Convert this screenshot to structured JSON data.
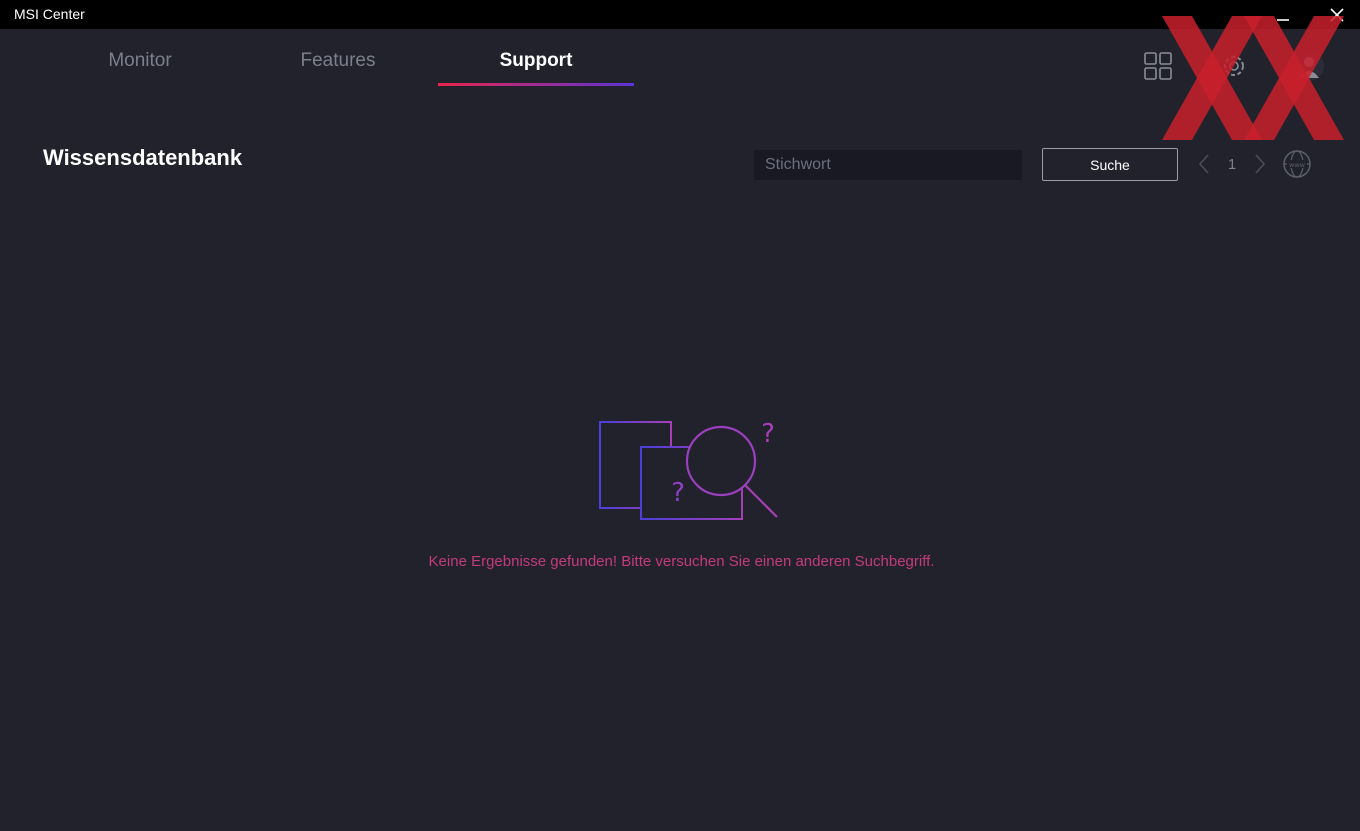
{
  "window": {
    "title": "MSI Center",
    "minimize_icon": "minimize-icon",
    "close_icon": "close-icon"
  },
  "tabs": [
    {
      "label": "Monitor",
      "active": false
    },
    {
      "label": "Features",
      "active": false
    },
    {
      "label": "Support",
      "active": true
    }
  ],
  "toolbar_icons": [
    "grid-icon",
    "gear-icon",
    "user-icon"
  ],
  "page": {
    "title": "Wissensdatenbank"
  },
  "search": {
    "placeholder": "Stichwort",
    "value": "",
    "button_label": "Suche"
  },
  "pager": {
    "current_page": "1",
    "prev_icon": "chevron-left-icon",
    "next_icon": "chevron-right-icon",
    "web_icon": "globe-www-icon"
  },
  "empty_state": {
    "icon": "no-results-illustration",
    "message": "Keine Ergebnisse gefunden! Bitte versuchen Sie einen anderen Suchbegriff."
  },
  "colors": {
    "background": "#21222c",
    "titlebar": "#000000",
    "tab_inactive": "#7c7f8c",
    "accent_red": "#e8254c",
    "accent_purple": "#5b34d6",
    "message": "#c53a7e",
    "watermark": "#c8202c"
  }
}
